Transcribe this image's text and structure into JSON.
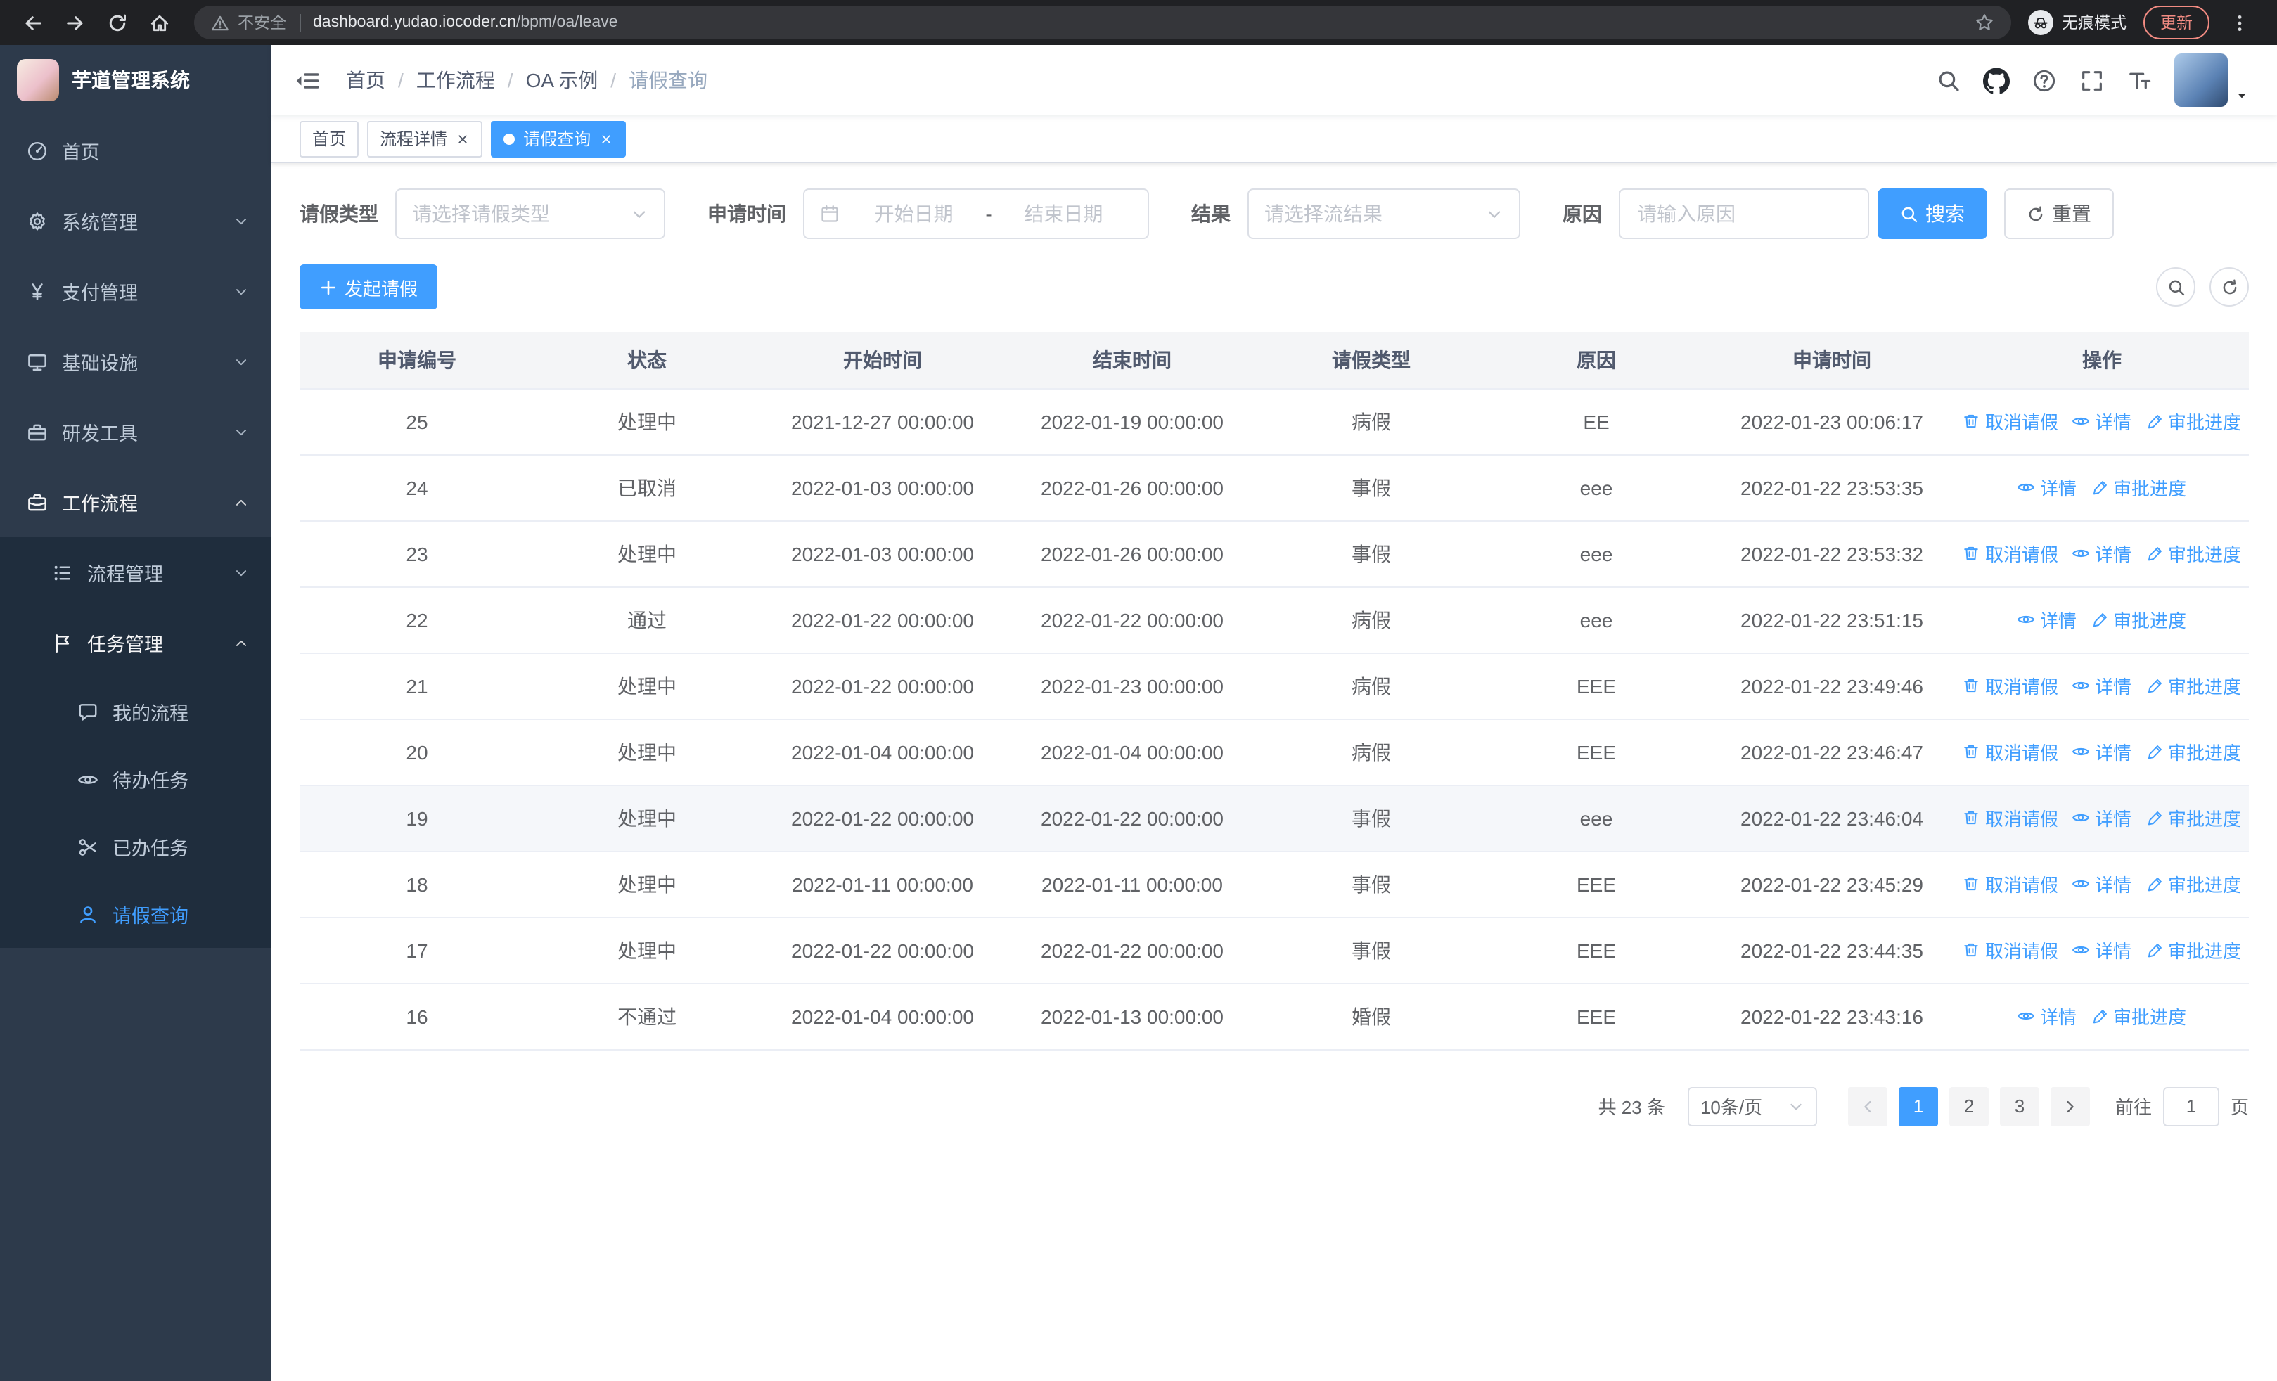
{
  "browser": {
    "security_label": "不安全",
    "url_domain": "dashboard.yudao.iocoder.cn",
    "url_path": "/bpm/oa/leave",
    "incognito_label": "无痕模式",
    "update_label": "更新"
  },
  "sidebar": {
    "logo_title": "芋道管理系统",
    "menu": [
      {
        "label": "首页",
        "icon": "dashboard",
        "level": 1
      },
      {
        "label": "系统管理",
        "icon": "gear",
        "level": 1,
        "chevron": "down"
      },
      {
        "label": "支付管理",
        "icon": "yen",
        "level": 1,
        "chevron": "down"
      },
      {
        "label": "基础设施",
        "icon": "monitor",
        "level": 1,
        "chevron": "down"
      },
      {
        "label": "研发工具",
        "icon": "toolbox",
        "level": 1,
        "chevron": "down"
      },
      {
        "label": "工作流程",
        "icon": "briefcase",
        "level": 1,
        "chevron": "up",
        "expanded": true
      },
      {
        "label": "流程管理",
        "icon": "tree",
        "level": 2,
        "chevron": "down"
      },
      {
        "label": "任务管理",
        "icon": "flag",
        "level": 2,
        "chevron": "up",
        "expanded": true
      },
      {
        "label": "我的流程",
        "icon": "chat",
        "level": 3
      },
      {
        "label": "待办任务",
        "icon": "eye",
        "level": 3
      },
      {
        "label": "已办任务",
        "icon": "scissors",
        "level": 3
      },
      {
        "label": "请假查询",
        "icon": "user",
        "level": 3,
        "active": true
      }
    ]
  },
  "header": {
    "breadcrumb": [
      "首页",
      "工作流程",
      "OA 示例",
      "请假查询"
    ]
  },
  "tabs": [
    {
      "label": "首页",
      "closable": false,
      "active": false
    },
    {
      "label": "流程详情",
      "closable": true,
      "active": false
    },
    {
      "label": "请假查询",
      "closable": true,
      "active": true
    }
  ],
  "filters": {
    "leave_type_label": "请假类型",
    "leave_type_placeholder": "请选择请假类型",
    "apply_time_label": "申请时间",
    "start_date_placeholder": "开始日期",
    "range_separator": "-",
    "end_date_placeholder": "结束日期",
    "result_label": "结果",
    "result_placeholder": "请选择流结果",
    "reason_label": "原因",
    "reason_placeholder": "请输入原因",
    "search_button": "搜索",
    "reset_button": "重置"
  },
  "toolbar": {
    "create_button": "发起请假"
  },
  "table": {
    "columns": [
      "申请编号",
      "状态",
      "开始时间",
      "结束时间",
      "请假类型",
      "原因",
      "申请时间",
      "操作"
    ],
    "action_labels": {
      "cancel": "取消请假",
      "detail": "详情",
      "progress": "审批进度"
    },
    "rows": [
      {
        "id": "25",
        "status": "处理中",
        "start": "2021-12-27 00:00:00",
        "end": "2022-01-19 00:00:00",
        "type": "病假",
        "reason": "EE",
        "apply_time": "2022-01-23 00:06:17",
        "cancellable": true
      },
      {
        "id": "24",
        "status": "已取消",
        "start": "2022-01-03 00:00:00",
        "end": "2022-01-26 00:00:00",
        "type": "事假",
        "reason": "eee",
        "apply_time": "2022-01-22 23:53:35",
        "cancellable": false
      },
      {
        "id": "23",
        "status": "处理中",
        "start": "2022-01-03 00:00:00",
        "end": "2022-01-26 00:00:00",
        "type": "事假",
        "reason": "eee",
        "apply_time": "2022-01-22 23:53:32",
        "cancellable": true
      },
      {
        "id": "22",
        "status": "通过",
        "start": "2022-01-22 00:00:00",
        "end": "2022-01-22 00:00:00",
        "type": "病假",
        "reason": "eee",
        "apply_time": "2022-01-22 23:51:15",
        "cancellable": false
      },
      {
        "id": "21",
        "status": "处理中",
        "start": "2022-01-22 00:00:00",
        "end": "2022-01-23 00:00:00",
        "type": "病假",
        "reason": "EEE",
        "apply_time": "2022-01-22 23:49:46",
        "cancellable": true
      },
      {
        "id": "20",
        "status": "处理中",
        "start": "2022-01-04 00:00:00",
        "end": "2022-01-04 00:00:00",
        "type": "病假",
        "reason": "EEE",
        "apply_time": "2022-01-22 23:46:47",
        "cancellable": true
      },
      {
        "id": "19",
        "status": "处理中",
        "start": "2022-01-22 00:00:00",
        "end": "2022-01-22 00:00:00",
        "type": "事假",
        "reason": "eee",
        "apply_time": "2022-01-22 23:46:04",
        "cancellable": true,
        "highlighted": true
      },
      {
        "id": "18",
        "status": "处理中",
        "start": "2022-01-11 00:00:00",
        "end": "2022-01-11 00:00:00",
        "type": "事假",
        "reason": "EEE",
        "apply_time": "2022-01-22 23:45:29",
        "cancellable": true
      },
      {
        "id": "17",
        "status": "处理中",
        "start": "2022-01-22 00:00:00",
        "end": "2022-01-22 00:00:00",
        "type": "事假",
        "reason": "EEE",
        "apply_time": "2022-01-22 23:44:35",
        "cancellable": true
      },
      {
        "id": "16",
        "status": "不通过",
        "start": "2022-01-04 00:00:00",
        "end": "2022-01-13 00:00:00",
        "type": "婚假",
        "reason": "EEE",
        "apply_time": "2022-01-22 23:43:16",
        "cancellable": false
      }
    ]
  },
  "pagination": {
    "total_text": "共 23 条",
    "page_size": "10条/页",
    "pages": [
      {
        "label": "1",
        "active": true
      },
      {
        "label": "2",
        "active": false
      },
      {
        "label": "3",
        "active": false
      }
    ],
    "goto_label": "前往",
    "goto_value": "1",
    "page_suffix": "页"
  },
  "colors": {
    "primary": "#409eff",
    "sidebar_bg": "#2d3a4b",
    "sidebar_submenu_bg": "#1f2d3d",
    "update_accent": "#f28b82"
  }
}
